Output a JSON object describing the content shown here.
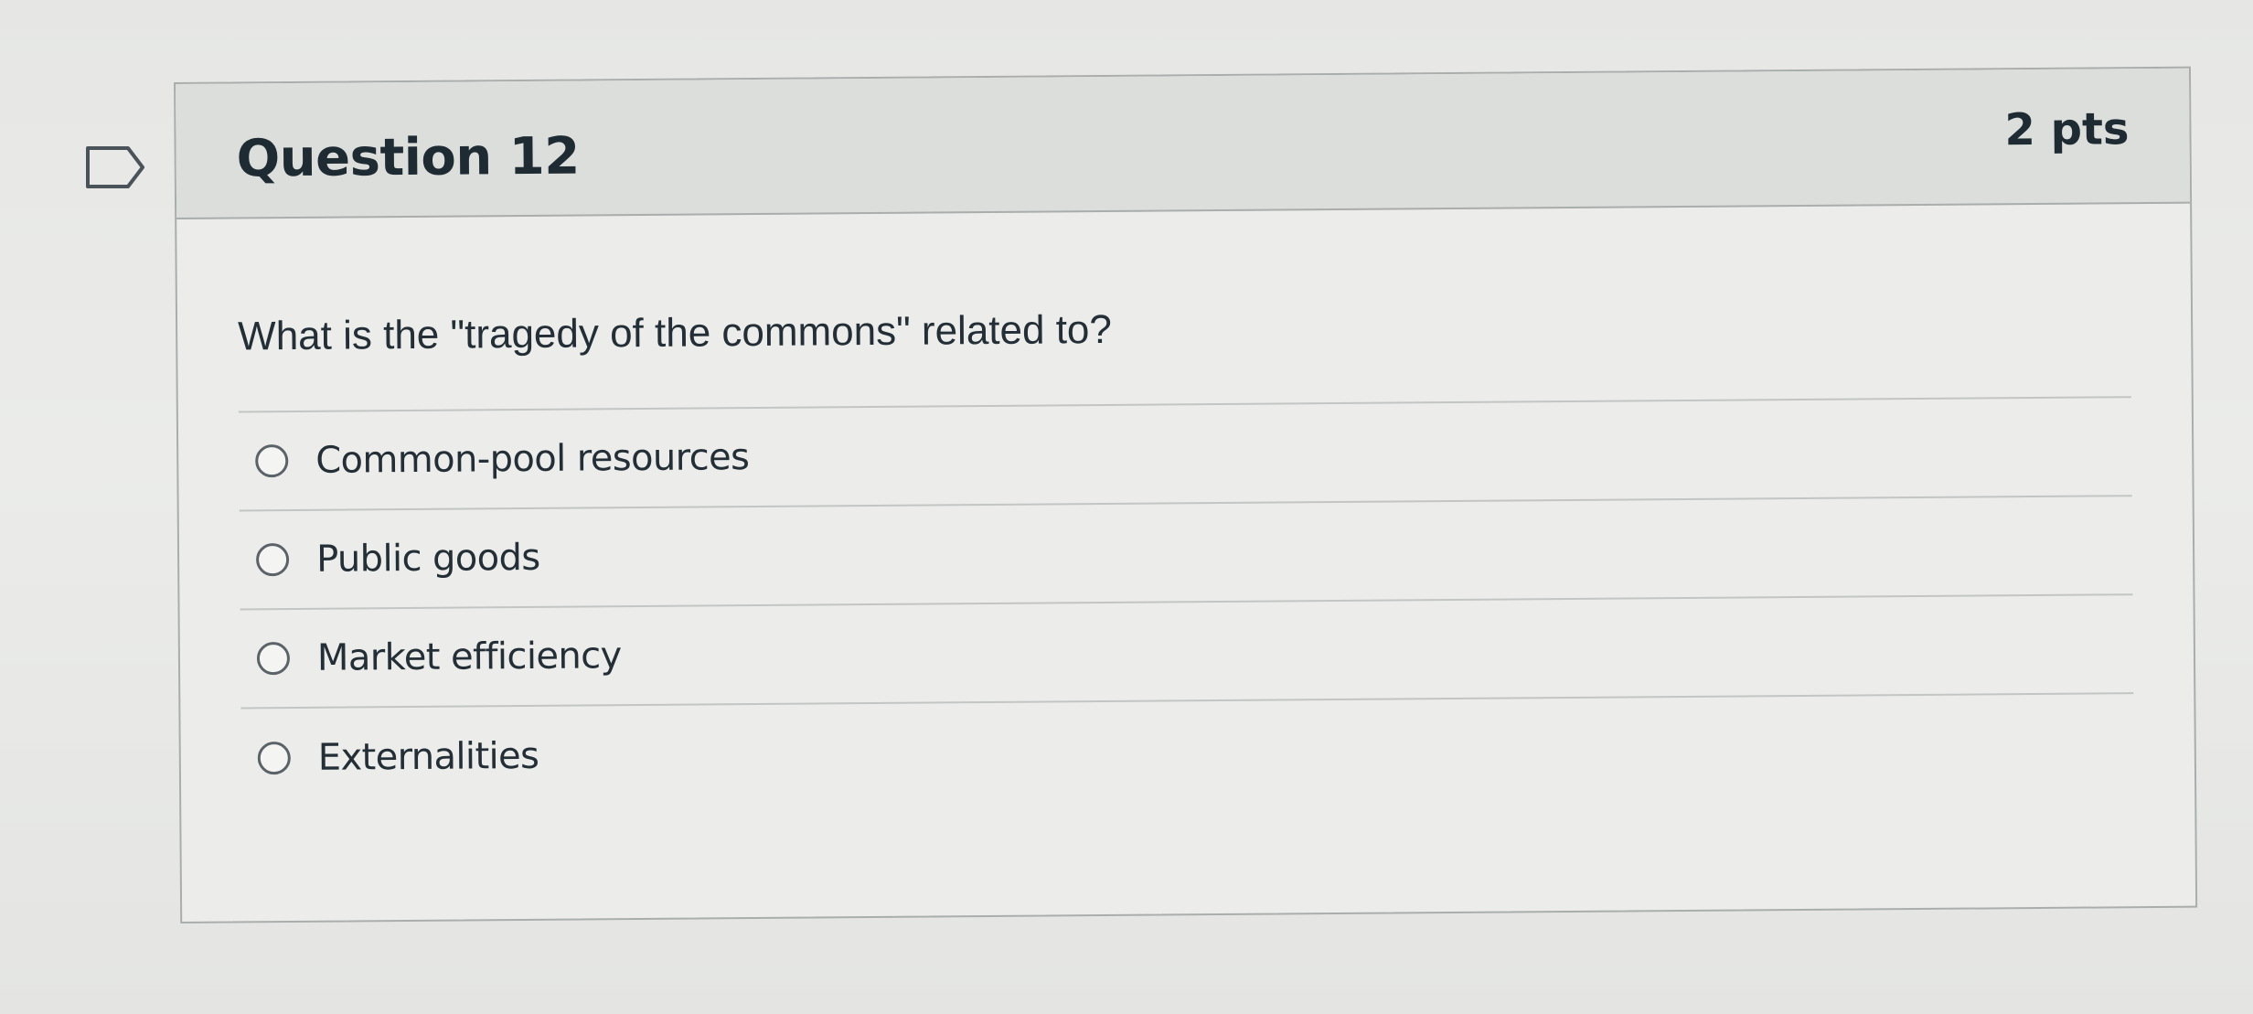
{
  "question": {
    "title": "Question 12",
    "points": "2 pts",
    "text": "What is the \"tragedy of the commons\" related to?",
    "flag_icon": "bookmark-flag-icon",
    "answers": [
      {
        "label": "Common-pool resources",
        "selected": false
      },
      {
        "label": "Public goods",
        "selected": false
      },
      {
        "label": "Market efficiency",
        "selected": false
      },
      {
        "label": "Externalities",
        "selected": false
      }
    ]
  },
  "colors": {
    "background": "#e9eae8",
    "header": "#dcdedc",
    "border": "#a9adab",
    "text": "#232e36"
  }
}
